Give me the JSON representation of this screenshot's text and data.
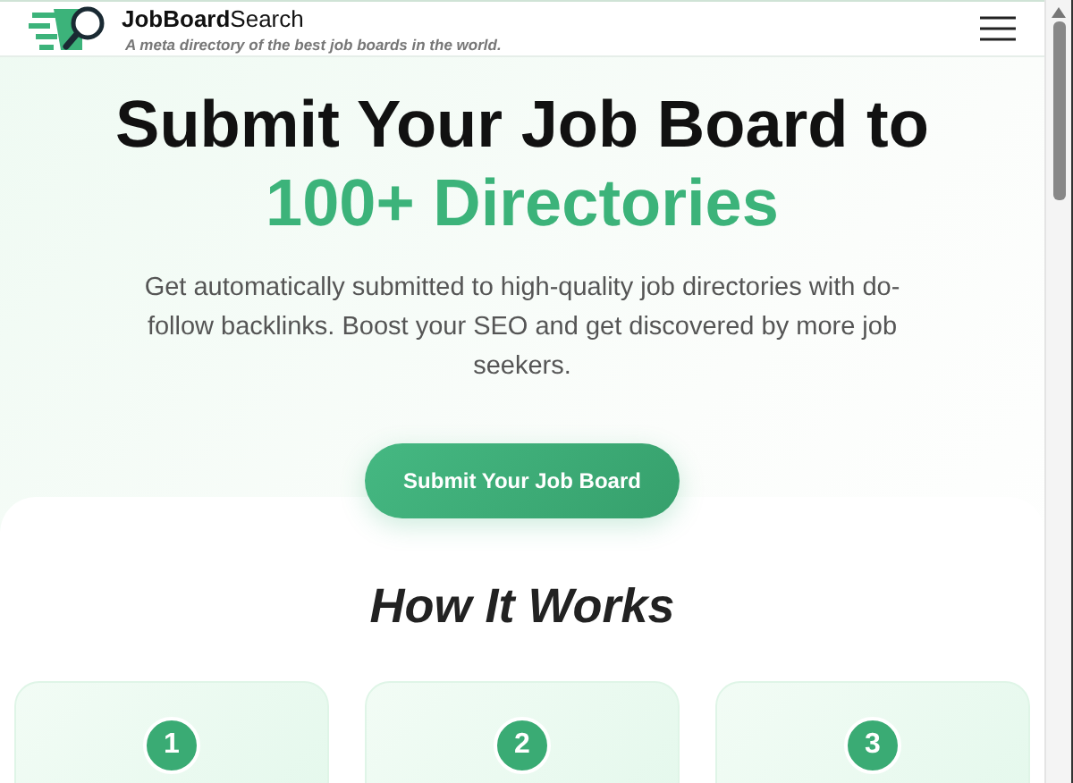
{
  "header": {
    "brand": "**JobBoard**Search",
    "tagline": "A meta directory of the best job boards in the world."
  },
  "hero": {
    "title": "Submit Your Job Board to",
    "highlight": "100+ Directories",
    "description": "Get automatically submitted to high-quality job directories with do-follow backlinks. Boost your SEO and get discovered by more job seekers.",
    "button": "Submit Your Job Board"
  },
  "how_it_works": {
    "heading": "How It Works",
    "steps": [
      {
        "number": "1"
      },
      {
        "number": "2"
      },
      {
        "number": "3"
      }
    ]
  }
}
